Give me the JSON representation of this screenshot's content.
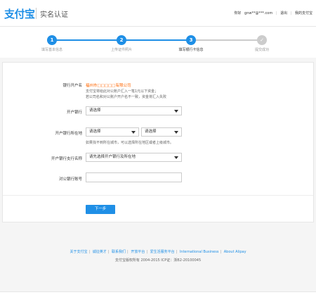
{
  "header": {
    "logo": "支付宝",
    "subtitle": "实名认证",
    "nav": {
      "greeting": "你好",
      "account": "gnw**@***.com",
      "logout": "退出",
      "my_alipay": "我的支付宝"
    }
  },
  "steps": [
    {
      "num": "1",
      "label": "填写基本信息",
      "state": "done"
    },
    {
      "num": "2",
      "label": "上传证件照片",
      "state": "done"
    },
    {
      "num": "3",
      "label": "填写银行卡信息",
      "state": "active"
    },
    {
      "num": "✓",
      "label": "提交成功",
      "state": "pending"
    }
  ],
  "form": {
    "account_name_label": "银行开户名",
    "account_name_value": "福州市□□□□□有限公司",
    "account_note_1": "支付宝将给此对公账户汇入一笔1元以下资金；",
    "account_note_2": "若公司名和对公账户开户名不一致，资金将汇入失败",
    "bank_label": "开户银行",
    "bank_value": "请选择",
    "location_label": "开户银行所在地",
    "province_value": "请选择",
    "city_value": "请选择",
    "location_note": "如果找不到所在城市，可以选择所在地区或者上级城市。",
    "branch_label": "开户银行支行名称",
    "branch_value": "请先选择开户银行及所在地",
    "account_no_label": "对公银行账号",
    "account_no_value": "",
    "next_button": "下一步"
  },
  "footer": {
    "links": [
      "关于支付宝",
      "诚征英才",
      "联系我们",
      "开放平台",
      "爱生活服务平台",
      "International Business",
      "About Alipay"
    ],
    "copyright": "支付宝版权所有 2004-2015 ICP证：浙B2-20100045"
  },
  "colors": {
    "brand": "#1f8fe6",
    "active_step": "#1f8fe6",
    "pending_step": "#cccccc",
    "account_name": "#ff6600"
  }
}
